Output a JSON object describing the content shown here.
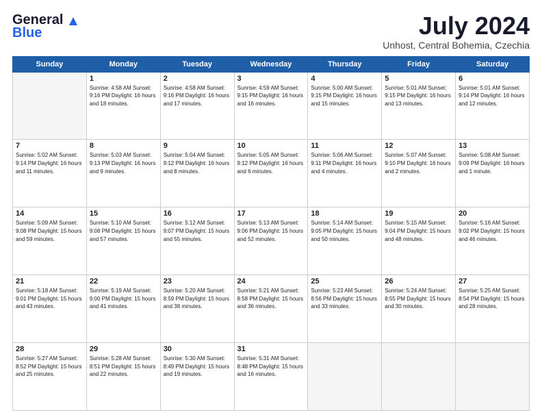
{
  "logo": {
    "general": "General",
    "blue": "Blue"
  },
  "title": "July 2024",
  "location": "Unhost, Central Bohemia, Czechia",
  "days_of_week": [
    "Sunday",
    "Monday",
    "Tuesday",
    "Wednesday",
    "Thursday",
    "Friday",
    "Saturday"
  ],
  "weeks": [
    [
      {
        "day": "",
        "info": ""
      },
      {
        "day": "1",
        "info": "Sunrise: 4:58 AM\nSunset: 9:16 PM\nDaylight: 16 hours\nand 18 minutes."
      },
      {
        "day": "2",
        "info": "Sunrise: 4:58 AM\nSunset: 9:16 PM\nDaylight: 16 hours\nand 17 minutes."
      },
      {
        "day": "3",
        "info": "Sunrise: 4:59 AM\nSunset: 9:15 PM\nDaylight: 16 hours\nand 16 minutes."
      },
      {
        "day": "4",
        "info": "Sunrise: 5:00 AM\nSunset: 9:15 PM\nDaylight: 16 hours\nand 15 minutes."
      },
      {
        "day": "5",
        "info": "Sunrise: 5:01 AM\nSunset: 9:15 PM\nDaylight: 16 hours\nand 13 minutes."
      },
      {
        "day": "6",
        "info": "Sunrise: 5:01 AM\nSunset: 9:14 PM\nDaylight: 16 hours\nand 12 minutes."
      }
    ],
    [
      {
        "day": "7",
        "info": "Sunrise: 5:02 AM\nSunset: 9:14 PM\nDaylight: 16 hours\nand 11 minutes."
      },
      {
        "day": "8",
        "info": "Sunrise: 5:03 AM\nSunset: 9:13 PM\nDaylight: 16 hours\nand 9 minutes."
      },
      {
        "day": "9",
        "info": "Sunrise: 5:04 AM\nSunset: 9:12 PM\nDaylight: 16 hours\nand 8 minutes."
      },
      {
        "day": "10",
        "info": "Sunrise: 5:05 AM\nSunset: 9:12 PM\nDaylight: 16 hours\nand 6 minutes."
      },
      {
        "day": "11",
        "info": "Sunrise: 5:06 AM\nSunset: 9:11 PM\nDaylight: 16 hours\nand 4 minutes."
      },
      {
        "day": "12",
        "info": "Sunrise: 5:07 AM\nSunset: 9:10 PM\nDaylight: 16 hours\nand 2 minutes."
      },
      {
        "day": "13",
        "info": "Sunrise: 5:08 AM\nSunset: 9:09 PM\nDaylight: 16 hours\nand 1 minute."
      }
    ],
    [
      {
        "day": "14",
        "info": "Sunrise: 5:09 AM\nSunset: 9:08 PM\nDaylight: 15 hours\nand 59 minutes."
      },
      {
        "day": "15",
        "info": "Sunrise: 5:10 AM\nSunset: 9:08 PM\nDaylight: 15 hours\nand 57 minutes."
      },
      {
        "day": "16",
        "info": "Sunrise: 5:12 AM\nSunset: 9:07 PM\nDaylight: 15 hours\nand 55 minutes."
      },
      {
        "day": "17",
        "info": "Sunrise: 5:13 AM\nSunset: 9:06 PM\nDaylight: 15 hours\nand 52 minutes."
      },
      {
        "day": "18",
        "info": "Sunrise: 5:14 AM\nSunset: 9:05 PM\nDaylight: 15 hours\nand 50 minutes."
      },
      {
        "day": "19",
        "info": "Sunrise: 5:15 AM\nSunset: 9:04 PM\nDaylight: 15 hours\nand 48 minutes."
      },
      {
        "day": "20",
        "info": "Sunrise: 5:16 AM\nSunset: 9:02 PM\nDaylight: 15 hours\nand 46 minutes."
      }
    ],
    [
      {
        "day": "21",
        "info": "Sunrise: 5:18 AM\nSunset: 9:01 PM\nDaylight: 15 hours\nand 43 minutes."
      },
      {
        "day": "22",
        "info": "Sunrise: 5:19 AM\nSunset: 9:00 PM\nDaylight: 15 hours\nand 41 minutes."
      },
      {
        "day": "23",
        "info": "Sunrise: 5:20 AM\nSunset: 8:59 PM\nDaylight: 15 hours\nand 38 minutes."
      },
      {
        "day": "24",
        "info": "Sunrise: 5:21 AM\nSunset: 8:58 PM\nDaylight: 15 hours\nand 36 minutes."
      },
      {
        "day": "25",
        "info": "Sunrise: 5:23 AM\nSunset: 8:56 PM\nDaylight: 15 hours\nand 33 minutes."
      },
      {
        "day": "26",
        "info": "Sunrise: 5:24 AM\nSunset: 8:55 PM\nDaylight: 15 hours\nand 30 minutes."
      },
      {
        "day": "27",
        "info": "Sunrise: 5:25 AM\nSunset: 8:54 PM\nDaylight: 15 hours\nand 28 minutes."
      }
    ],
    [
      {
        "day": "28",
        "info": "Sunrise: 5:27 AM\nSunset: 8:52 PM\nDaylight: 15 hours\nand 25 minutes."
      },
      {
        "day": "29",
        "info": "Sunrise: 5:28 AM\nSunset: 8:51 PM\nDaylight: 15 hours\nand 22 minutes."
      },
      {
        "day": "30",
        "info": "Sunrise: 5:30 AM\nSunset: 8:49 PM\nDaylight: 15 hours\nand 19 minutes."
      },
      {
        "day": "31",
        "info": "Sunrise: 5:31 AM\nSunset: 8:48 PM\nDaylight: 15 hours\nand 16 minutes."
      },
      {
        "day": "",
        "info": ""
      },
      {
        "day": "",
        "info": ""
      },
      {
        "day": "",
        "info": ""
      }
    ]
  ]
}
